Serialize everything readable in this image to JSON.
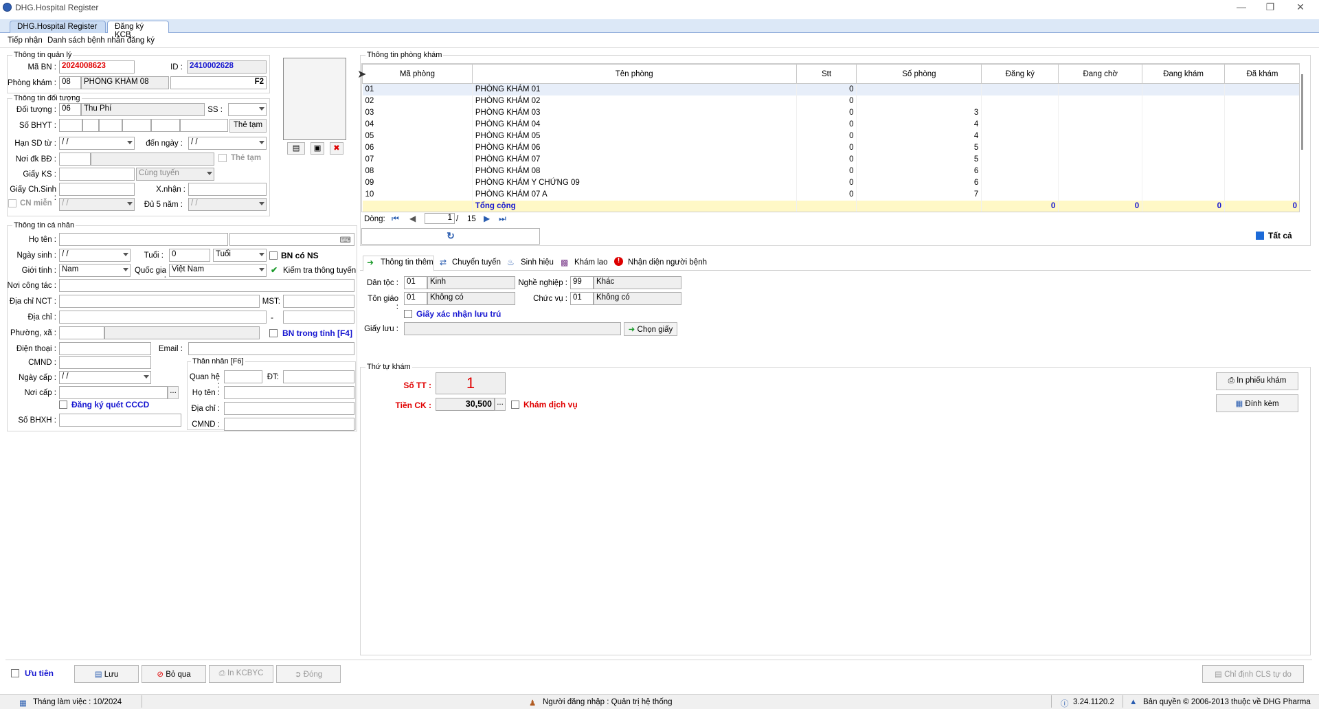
{
  "window": {
    "title": "DHG.Hospital Register"
  },
  "tabs": [
    "DHG.Hospital Register",
    "Đăng ký KCB"
  ],
  "subtabs": [
    "Tiếp nhận",
    "Danh sách bệnh nhân đăng ký"
  ],
  "quanly": {
    "title": "Thông tin quản lý",
    "ma_bn_label": "Mã BN :",
    "ma_bn": "2024008623",
    "id_label": "ID :",
    "id": "2410002628",
    "phong_kham_label": "Phòng khám :",
    "pk_code": "08",
    "pk_name": "PHÒNG KHÁM 08",
    "f2": "F2"
  },
  "doituong": {
    "title": "Thông tin đối tượng",
    "doi_tuong_label": "Đối tượng :",
    "dt_code": "06",
    "dt_name": "Thu Phí",
    "ss_label": "SS :",
    "so_bhyt_label": "Số BHYT :",
    "the_tam_btn": "Thẻ tạm",
    "han_sd_label": "Hạn SD từ :",
    "den_ngay_label": "đến ngày :",
    "date_blank": " /   /",
    "noi_dk_label": "Nơi đk BĐ :",
    "the_tam_chk": "Thẻ tạm",
    "giay_ks_label": "Giấy KS :",
    "cung_tuyen": "Cùng tuyến",
    "giay_chsinh_label": "Giấy Ch.Sinh :",
    "xnhan_label": "X.nhận :",
    "cn_mien": "CN miễn",
    "du5nam_label": "Đủ 5 năm :"
  },
  "canhan": {
    "title": "Thông tin cá nhân",
    "ho_ten_label": "Họ tên :",
    "ngay_sinh_label": "Ngày sinh :",
    "tuoi_label": "Tuổi :",
    "tuoi_val": "0",
    "tuoi_unit": "Tuổi",
    "bn_co_ns": "BN có NS",
    "gioi_tinh_label": "Giới tính :",
    "gioi_tinh": "Nam",
    "quoc_gia_label": "Quốc gia :",
    "quoc_gia": "Việt Nam",
    "kiem_tra": "Kiểm tra thông tuyến",
    "noi_cong_tac_label": "Nơi công tác :",
    "dia_chi_nct_label": "Địa chỉ  NCT :",
    "mst_label": "MST:",
    "dia_chi_label": "Địa chỉ :",
    "dash": "-",
    "phuong_xa_label": "Phường, xã :",
    "bn_trong_tinh": "BN trong tỉnh [F4]",
    "dien_thoai_label": "Điện thoại :",
    "email_label": "Email :",
    "cmnd_label": "CMND :",
    "ngay_cap_label": "Ngày cấp :",
    "noi_cap_label": "Nơi cấp :",
    "dots": "...",
    "dk_quet": "Đăng ký quét CCCD",
    "so_bhxh_label": "Số BHXH :"
  },
  "thannhan": {
    "title": "Thân nhân [F6]",
    "quan_he": "Quan hệ :",
    "dt": "ĐT:",
    "ho_ten": "Họ tên :",
    "dia_chi": "Địa chỉ :",
    "cmnd": "CMND :"
  },
  "phongkham": {
    "title": "Thông tin phòng khám",
    "columns": [
      "Mã phòng",
      "Tên phòng",
      "Stt",
      "Số phòng",
      "Đăng ký",
      "Đang chờ",
      "Đang khám",
      "Đã khám"
    ],
    "rows": [
      [
        "01",
        "PHÒNG KHÁM 01",
        "0",
        ""
      ],
      [
        "02",
        "PHÒNG KHÁM 02",
        "0",
        ""
      ],
      [
        "03",
        "PHÒNG KHÁM 03",
        "0",
        "3"
      ],
      [
        "04",
        "PHÒNG KHÁM 04",
        "0",
        "4"
      ],
      [
        "05",
        "PHÒNG KHÁM 05",
        "0",
        "4"
      ],
      [
        "06",
        "PHÒNG KHÁM 06",
        "0",
        "5"
      ],
      [
        "07",
        "PHÒNG KHÁM 07",
        "0",
        "5"
      ],
      [
        "08",
        "PHÒNG KHÁM 08",
        "0",
        "6"
      ],
      [
        "09",
        "PHÒNG KHÁM Y CHỨNG 09",
        "0",
        "6"
      ],
      [
        "10",
        "PHÒNG KHÁM 07 A",
        "0",
        "7"
      ]
    ],
    "total_label": "Tổng cộng",
    "totals": [
      "0",
      "0",
      "0",
      "0"
    ],
    "dong_label": "Dòng:",
    "page": "1",
    "page_sep": "/",
    "page_total": "15",
    "tat_ca": "Tất cả"
  },
  "themtabs": [
    "Thông tin thêm",
    "Chuyển tuyến",
    "Sinh hiệu",
    "Khám lao",
    "Nhận diện người bệnh"
  ],
  "them": {
    "dan_toc_label": "Dân tộc :",
    "dan_toc_code": "01",
    "dan_toc": "Kinh",
    "nghe_nghiep_label": "Nghề nghiệp :",
    "nn_code": "99",
    "nn": "Khác",
    "ton_giao_label": "Tôn giáo :",
    "tg_code": "01",
    "tg": "Không có",
    "chuc_vu_label": "Chức vụ :",
    "cv_code": "01",
    "cv": "Không có",
    "giay_xac_nhan": "Giấy xác nhận lưu trú",
    "giay_luu_label": "Giấy lưu :",
    "chon_giay": "Chọn giấy"
  },
  "thutu": {
    "title": "Thứ tự khám",
    "so_tt_label": "Số TT :",
    "so_tt": "1",
    "tien_ck_label": "Tiền CK :",
    "tien_ck": "30,500",
    "dots": "...",
    "kham_dv": "Khám dịch vụ",
    "in_phieu": "In phiếu khám",
    "dinh_kem": "Đính kèm"
  },
  "bottom": {
    "uu_tien": "Ưu tiên",
    "luu": "Lưu",
    "bo_qua": "Bỏ qua",
    "in_kcbyc": "In KCBYC",
    "dong": "Đóng",
    "chi_dinh": "Chỉ định CLS tự do"
  },
  "status": {
    "thang": "Tháng làm việc : 10/2024",
    "nguoi": "Người đăng nhập : Quản trị hệ thống",
    "version": "3.24.1120.2",
    "copyright": "Bản quyền © 2006-2013 thuộc về DHG Pharma"
  },
  "colors": {
    "accent_red": "#e00000",
    "accent_blue": "#1515d0",
    "total_bg": "#fff8c6"
  }
}
